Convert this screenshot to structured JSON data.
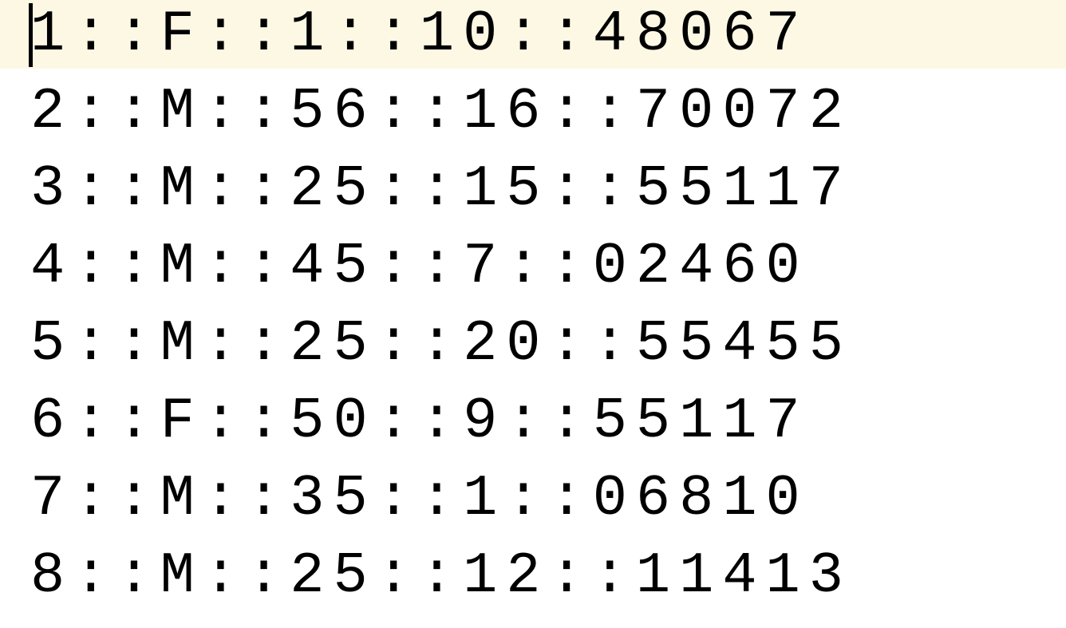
{
  "editor": {
    "lines": [
      "1::F::1::10::48067",
      "2::M::56::16::70072",
      "3::M::25::15::55117",
      "4::M::45::7::02460",
      "5::M::25::20::55455",
      "6::F::50::9::55117",
      "7::M::35::1::06810",
      "8::M::25::12::11413"
    ],
    "current_line_index": 0,
    "colors": {
      "background": "#ffffff",
      "current_line_highlight": "#fdf8e4",
      "text": "#000000"
    }
  }
}
